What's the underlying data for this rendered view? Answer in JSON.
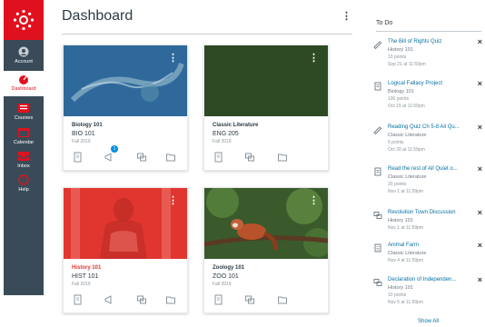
{
  "nav": {
    "items": [
      {
        "label": "Account",
        "icon": "account-icon"
      },
      {
        "label": "Dashboard",
        "icon": "dashboard-icon"
      },
      {
        "label": "Courses",
        "icon": "courses-icon"
      },
      {
        "label": "Calendar",
        "icon": "calendar-icon"
      },
      {
        "label": "Inbox",
        "icon": "inbox-icon"
      },
      {
        "label": "Help",
        "icon": "help-icon"
      }
    ]
  },
  "header": {
    "title": "Dashboard"
  },
  "cards": [
    {
      "name": "Biology 101",
      "code": "BIO 101",
      "term": "Fall 2019",
      "color": "#2a6fa8",
      "badge": "1"
    },
    {
      "name": "Classic Literature",
      "code": "ENG 205",
      "term": "Fall 2019",
      "color": "#2e4a24"
    },
    {
      "name": "History 101",
      "code": "HIST 101",
      "term": "Fall 2019",
      "color": "#e0362f"
    },
    {
      "name": "Zoology 101",
      "code": "ZOO 101",
      "term": "Fall 2019",
      "color": "#3a5a2c"
    }
  ],
  "todo": {
    "heading": "To Do",
    "show_all": "Show All",
    "items": [
      {
        "title": "The Bill of Rights Quiz",
        "course": "History 101",
        "points": "10 points",
        "due": "Sep 21 at 11:59pm",
        "icon": "quiz-icon"
      },
      {
        "title": "Logical Fallacy Project",
        "course": "Biology 101",
        "points": "100 points",
        "due": "Oct 15 at 11:59pm",
        "icon": "assignment-icon"
      },
      {
        "title": "Reading Quiz Ch 5-8 All Qu...",
        "course": "Classic Literature",
        "points": "5 points",
        "due": "Oct 30 at 11:59pm",
        "icon": "quiz-icon"
      },
      {
        "title": "Read the rest of All Quiet o...",
        "course": "Classic Literature",
        "points": "20 points",
        "due": "Nov 1 at 11:59pm",
        "icon": "assignment-icon"
      },
      {
        "title": "Revolution Town Discussion",
        "course": "History 101",
        "points": "",
        "due": "Nov 1 at 11:59pm",
        "icon": "discussion-icon"
      },
      {
        "title": "Animal Farm",
        "course": "Classic Literature",
        "points": "",
        "due": "Nov 4 at 11:59pm",
        "icon": "page-icon"
      },
      {
        "title": "Declaration of Independen...",
        "course": "History 101",
        "points": "10 points",
        "due": "Nov 5 at 11:59pm",
        "icon": "discussion-icon"
      }
    ]
  }
}
